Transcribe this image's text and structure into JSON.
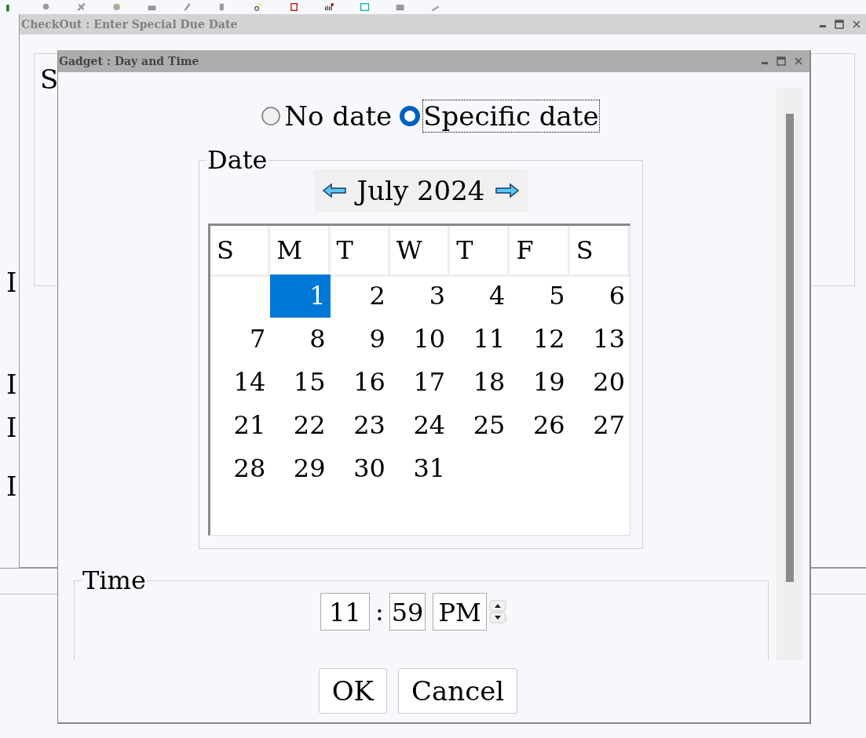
{
  "background_letters": [
    "I",
    "I",
    "I",
    "I"
  ],
  "outer_window": {
    "title": "CheckOut : Enter Special Due Date",
    "letters": [
      "S"
    ]
  },
  "dialog": {
    "title": "Gadget : Day and Time",
    "date_options": [
      {
        "label": "No date",
        "selected": false
      },
      {
        "label": "Specific date",
        "selected": true
      }
    ],
    "date_group": {
      "title": "Date",
      "month": "July 2024",
      "weekdays": [
        "S",
        "M",
        "T",
        "W",
        "T",
        "F",
        "S"
      ],
      "weeks": [
        {
          "days": [
            {
              "label": "1",
              "selected": true
            },
            {
              "label": "2",
              "selected": false
            },
            {
              "label": "3",
              "selected": false
            },
            {
              "label": "4",
              "selected": false
            },
            {
              "label": "5",
              "selected": false
            },
            {
              "label": "6",
              "selected": false
            }
          ]
        },
        {
          "days": [
            {
              "label": "7",
              "selected": false
            },
            {
              "label": "8",
              "selected": false
            },
            {
              "label": "9",
              "selected": false
            },
            {
              "label": "10",
              "selected": false
            },
            {
              "label": "11",
              "selected": false
            },
            {
              "label": "12",
              "selected": false
            },
            {
              "label": "13",
              "selected": false
            }
          ]
        },
        {
          "days": [
            {
              "label": "14",
              "selected": false
            },
            {
              "label": "15",
              "selected": false
            },
            {
              "label": "16",
              "selected": false
            },
            {
              "label": "17",
              "selected": false
            },
            {
              "label": "18",
              "selected": false
            },
            {
              "label": "19",
              "selected": false
            },
            {
              "label": "20",
              "selected": false
            }
          ]
        },
        {
          "days": [
            {
              "label": "21",
              "selected": false
            },
            {
              "label": "22",
              "selected": false
            },
            {
              "label": "23",
              "selected": false
            },
            {
              "label": "24",
              "selected": false
            },
            {
              "label": "25",
              "selected": false
            },
            {
              "label": "26",
              "selected": false
            },
            {
              "label": "27",
              "selected": false
            }
          ]
        },
        {
          "days": [
            {
              "label": "28",
              "selected": false
            },
            {
              "label": "29",
              "selected": false
            },
            {
              "label": "30",
              "selected": false
            },
            {
              "label": "31",
              "selected": false
            }
          ]
        }
      ]
    },
    "time_group": {
      "title": "Time",
      "hour": "11",
      "separator": ":",
      "minute": "59",
      "period": "PM"
    },
    "buttons": [
      "OK",
      "Cancel"
    ]
  }
}
